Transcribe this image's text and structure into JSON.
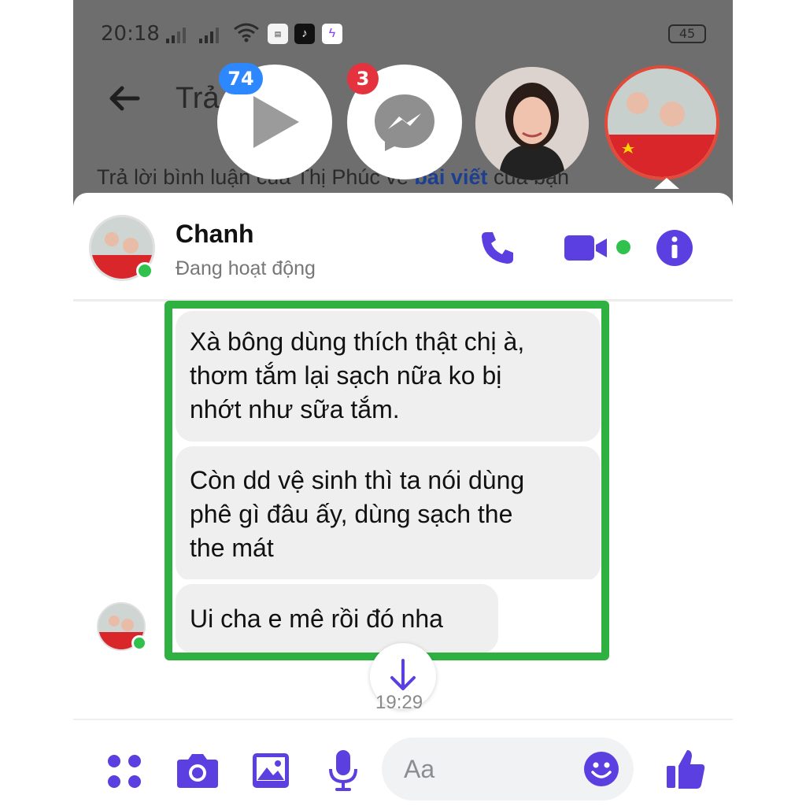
{
  "status_bar": {
    "time": "20:18",
    "battery": "45",
    "app_icons": [
      "news-app-icon",
      "tiktok-icon",
      "messenger-icon"
    ]
  },
  "header": {
    "title_partial": "Trả",
    "reply_caption_prefix": "Trả lời bình luận của Thị Phúc về ",
    "reply_caption_link": "bài viết",
    "reply_caption_suffix": " của bạn"
  },
  "chat_heads": [
    {
      "type": "video",
      "badge": "74"
    },
    {
      "type": "messenger",
      "badge": "3"
    },
    {
      "type": "contact-photo",
      "badge": ""
    },
    {
      "type": "active-contact-photo",
      "badge": ""
    }
  ],
  "conversation": {
    "contact_name": "Chanh",
    "contact_status": "Đang hoạt động",
    "accent_color": "#5b3fe0",
    "online_color": "#31c24d",
    "highlight_color": "#2fb142"
  },
  "messages": [
    {
      "line1": "Xà bông dùng thích thật chị à,",
      "line2": "thơm tắm lại sạch nữa ko bị",
      "line3": "nhớt như sữa tắm."
    },
    {
      "line1": "Còn dd vệ sinh thì ta nói dùng",
      "line2": "phê gì đâu ấy, dùng sạch the",
      "line3": "the mát"
    },
    {
      "line1": "Ui cha e mê rồi đó nha"
    }
  ],
  "timestamp": "19:29",
  "composer": {
    "placeholder": "Aa",
    "tools": [
      "menu-dots-icon",
      "camera-icon",
      "image-icon",
      "microphone-icon"
    ],
    "send_icon": "thumbs-up-icon"
  }
}
